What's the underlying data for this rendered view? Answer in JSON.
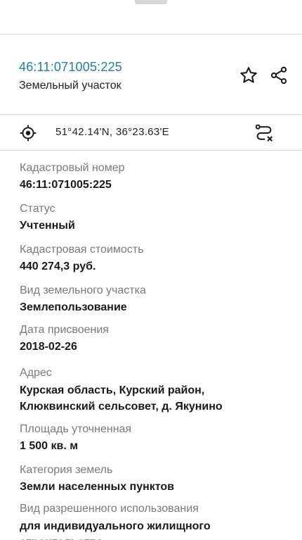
{
  "header": {
    "cadastral_number": "46:11:071005:225",
    "object_type": "Земельный участок",
    "icons": {
      "favorite": "star-icon",
      "share": "share-icon"
    }
  },
  "location": {
    "coordinates": "51°42.14'N, 36°23.63'E",
    "icons": {
      "locate": "crosshair-icon",
      "route": "route-icon"
    }
  },
  "fields": [
    {
      "label": "Кадастровый номер",
      "value": "46:11:071005:225"
    },
    {
      "label": "Статус",
      "value": "Учтенный"
    },
    {
      "label": "Кадастровая стоимость",
      "value": "440 274,3 руб."
    },
    {
      "label": "Вид земельного участка",
      "value": "Землепользование"
    },
    {
      "label": "Дата присвоения",
      "value": "2018-02-26"
    },
    {
      "label": "Адрес",
      "value_lines": [
        "Курская область, Курский район,",
        "Клюквинский сельсовет, д. Якунино"
      ]
    },
    {
      "label": "Площадь уточненная",
      "value": "1 500 кв. м"
    },
    {
      "label": "Категория земель",
      "value": "Земли населенных пунктов"
    },
    {
      "label": "Вид разрешенного использования",
      "value_lines": [
        "для индивидуального жилищного",
        "строительства"
      ]
    }
  ],
  "colors": {
    "link": "#1f7fa8",
    "label": "#7a7a7a",
    "divider": "#dcdcdc"
  }
}
